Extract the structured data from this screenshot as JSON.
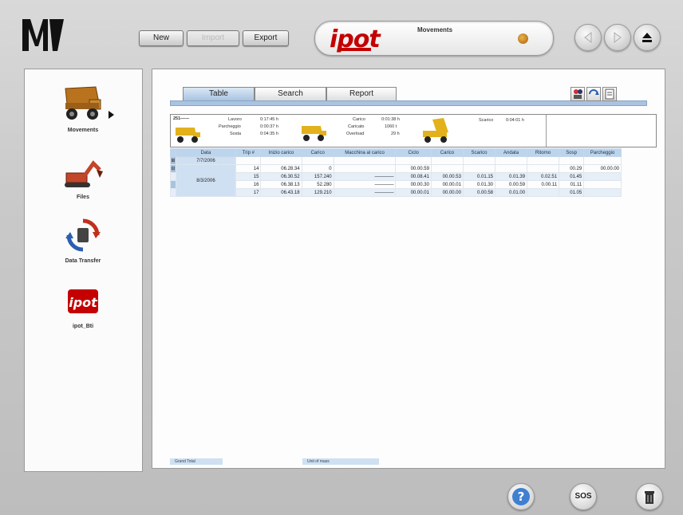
{
  "toolbar": {
    "new_label": "New",
    "import_label": "Import",
    "export_label": "Export"
  },
  "header": {
    "app_logo": "ipot",
    "title": "Movements"
  },
  "sidebar": {
    "items": [
      {
        "label": "Movements",
        "icon": "dump-truck-icon"
      },
      {
        "label": "Files",
        "icon": "excavator-icon"
      },
      {
        "label": "Data Transfer",
        "icon": "data-transfer-icon"
      },
      {
        "label": "ipot_Bti",
        "icon": "ipot-logo-icon"
      }
    ]
  },
  "tabs": [
    {
      "label": "Table",
      "active": true
    },
    {
      "label": "Search",
      "active": false
    },
    {
      "label": "Report",
      "active": false
    }
  ],
  "summary": {
    "id": "251——",
    "lavoro_label": "Lavoro",
    "lavoro_value": "0:17:45 h",
    "parcheggio_label": "Parcheggio",
    "parcheggio_value": "0:00:37 h",
    "sosta_label": "Sosta",
    "sosta_value": "0:04:35 h",
    "carico_label": "Carico",
    "carico_value": "0:01:38 h",
    "caricato_label": "Caricato",
    "caricato_value": "1060 t",
    "overload_label": "Overload",
    "overload_value": "29 h",
    "scarico_label": "Scarico",
    "scarico_value": "0:04:01 h"
  },
  "table": {
    "columns": [
      "Data",
      "Trip #",
      "Inizio carico",
      "Carico",
      "Macchina al carico",
      "Ciclo",
      "Carico",
      "Scarico",
      "Andata",
      "Ritorno",
      "Sosp",
      "Parcheggio"
    ],
    "groups": [
      {
        "date": "7/7/2006",
        "rows": []
      },
      {
        "date": "8/3/2006",
        "rows": [
          [
            "14",
            "06.28.34",
            "0",
            "",
            "00.00.59",
            "",
            "",
            "",
            "",
            "00.29",
            "00.00.00"
          ],
          [
            "15",
            "06.30.52",
            "157.240",
            "————",
            "00.08.41",
            "00.00.53",
            "0.01.15",
            "0.01.39",
            "0.02.51",
            "01.45",
            ""
          ],
          [
            "16",
            "06.38.13",
            "52.280",
            "————",
            "00.00.30",
            "00.00.01",
            "0.01.30",
            "0.00.59",
            "0.00.11",
            "01.11",
            ""
          ],
          [
            "17",
            "06.43.18",
            "129.210",
            "————",
            "00.00.01",
            "00.00.00",
            "0.00.58",
            "0.01.00",
            "",
            "01.05",
            ""
          ]
        ]
      }
    ]
  },
  "footer": {
    "grand_total_label": "Grand Total",
    "unit_label": "Unit of mass"
  },
  "bottom": {
    "help_label": "?",
    "sos_label": "SOS"
  },
  "colors": {
    "accent_blue": "#a9c3e0",
    "header_blue": "#bcd5ee",
    "brand_red": "#c40000"
  }
}
